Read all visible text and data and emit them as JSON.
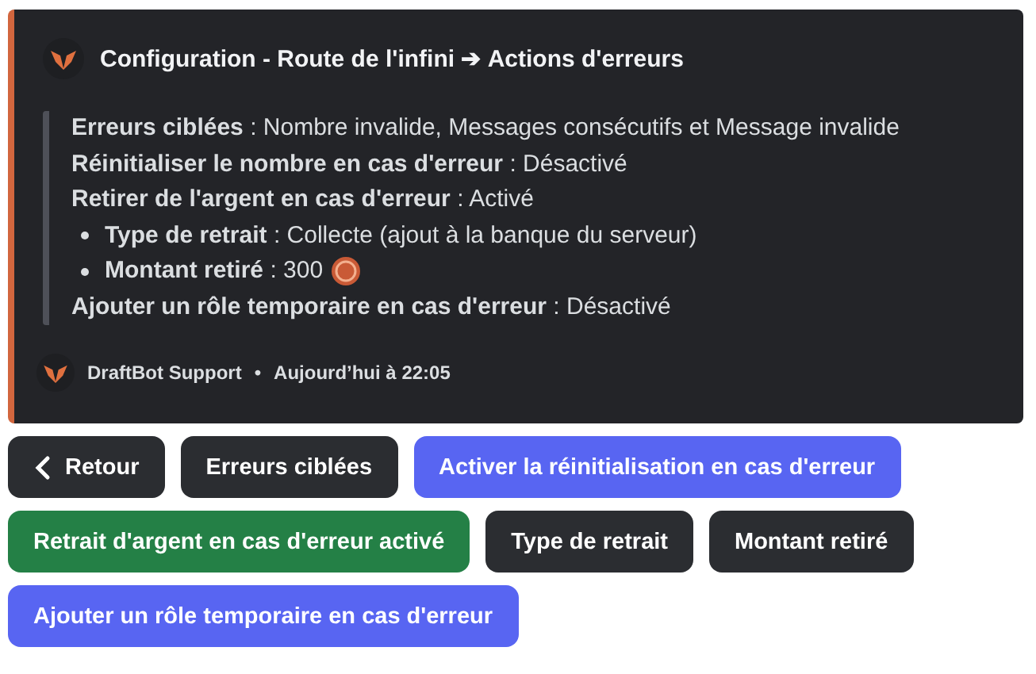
{
  "embed": {
    "title": "Configuration - Route de l'infini ➔ Actions d'erreurs",
    "fields": [
      {
        "kind": "line",
        "label": "Erreurs ciblées",
        "value": ": Nombre invalide, Messages consécutifs et Message invalide"
      },
      {
        "kind": "line",
        "label": "Réinitialiser le nombre en cas d'erreur",
        "value": ": Désactivé"
      },
      {
        "kind": "line",
        "label": "Retirer de l'argent en cas d'erreur",
        "value": ": Activé"
      },
      {
        "kind": "bullet",
        "label": "Type de retrait",
        "value": ": Collecte (ajout à la banque du serveur)"
      },
      {
        "kind": "bullet",
        "label": "Montant retiré",
        "value": ": 300",
        "coin": true
      },
      {
        "kind": "line",
        "label": "Ajouter un rôle temporaire en cas d'erreur",
        "value": ": Désactivé"
      }
    ],
    "footer": {
      "author": "DraftBot Support",
      "separator": "•",
      "time": "Aujourd’hui à 22:05"
    }
  },
  "button_rows": [
    [
      {
        "label": "Retour",
        "kind": "back"
      },
      {
        "label": "Erreurs ciblées",
        "kind": "secondary"
      },
      {
        "label": "Activer la réinitialisation en cas d'erreur",
        "kind": "primary"
      }
    ],
    [
      {
        "label": "Retrait d'argent en cas d'erreur activé",
        "kind": "success"
      },
      {
        "label": "Type de retrait",
        "kind": "secondary"
      },
      {
        "label": "Montant retiré",
        "kind": "secondary"
      }
    ],
    [
      {
        "label": "Ajouter un rôle temporaire en cas d'erreur",
        "kind": "primary"
      }
    ]
  ]
}
